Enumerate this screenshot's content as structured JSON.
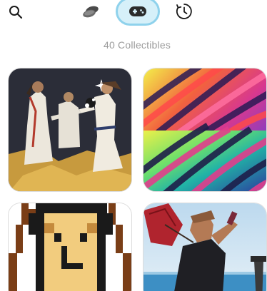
{
  "header": {
    "icons": [
      "search-icon",
      "coins-icon",
      "gamepad-icon",
      "clock-history-icon"
    ],
    "active_tab": "gamepad-icon",
    "active_color": "#8fd2ec"
  },
  "collection": {
    "count_label": "40 Collectibles"
  },
  "cards": [
    {
      "name": "dancers-artwork"
    },
    {
      "name": "psychedelic-waves-artwork"
    },
    {
      "name": "pixel-character-artwork"
    },
    {
      "name": "man-with-umbrella-artwork"
    }
  ]
}
